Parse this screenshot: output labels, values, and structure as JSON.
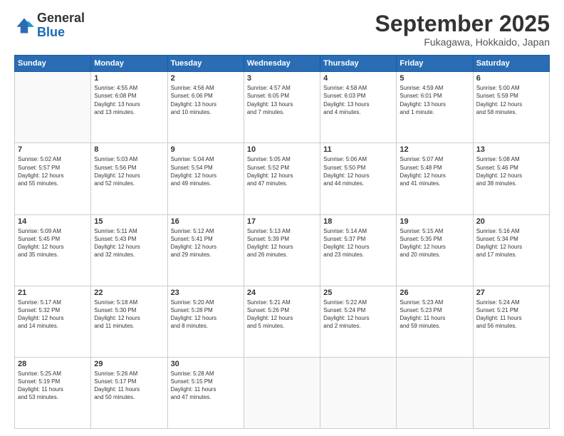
{
  "header": {
    "logo_general": "General",
    "logo_blue": "Blue",
    "month_title": "September 2025",
    "location": "Fukagawa, Hokkaido, Japan"
  },
  "weekdays": [
    "Sunday",
    "Monday",
    "Tuesday",
    "Wednesday",
    "Thursday",
    "Friday",
    "Saturday"
  ],
  "weeks": [
    [
      {
        "day": "",
        "info": ""
      },
      {
        "day": "1",
        "info": "Sunrise: 4:55 AM\nSunset: 6:08 PM\nDaylight: 13 hours\nand 13 minutes."
      },
      {
        "day": "2",
        "info": "Sunrise: 4:56 AM\nSunset: 6:06 PM\nDaylight: 13 hours\nand 10 minutes."
      },
      {
        "day": "3",
        "info": "Sunrise: 4:57 AM\nSunset: 6:05 PM\nDaylight: 13 hours\nand 7 minutes."
      },
      {
        "day": "4",
        "info": "Sunrise: 4:58 AM\nSunset: 6:03 PM\nDaylight: 13 hours\nand 4 minutes."
      },
      {
        "day": "5",
        "info": "Sunrise: 4:59 AM\nSunset: 6:01 PM\nDaylight: 13 hours\nand 1 minute."
      },
      {
        "day": "6",
        "info": "Sunrise: 5:00 AM\nSunset: 5:59 PM\nDaylight: 12 hours\nand 58 minutes."
      }
    ],
    [
      {
        "day": "7",
        "info": "Sunrise: 5:02 AM\nSunset: 5:57 PM\nDaylight: 12 hours\nand 55 minutes."
      },
      {
        "day": "8",
        "info": "Sunrise: 5:03 AM\nSunset: 5:56 PM\nDaylight: 12 hours\nand 52 minutes."
      },
      {
        "day": "9",
        "info": "Sunrise: 5:04 AM\nSunset: 5:54 PM\nDaylight: 12 hours\nand 49 minutes."
      },
      {
        "day": "10",
        "info": "Sunrise: 5:05 AM\nSunset: 5:52 PM\nDaylight: 12 hours\nand 47 minutes."
      },
      {
        "day": "11",
        "info": "Sunrise: 5:06 AM\nSunset: 5:50 PM\nDaylight: 12 hours\nand 44 minutes."
      },
      {
        "day": "12",
        "info": "Sunrise: 5:07 AM\nSunset: 5:48 PM\nDaylight: 12 hours\nand 41 minutes."
      },
      {
        "day": "13",
        "info": "Sunrise: 5:08 AM\nSunset: 5:46 PM\nDaylight: 12 hours\nand 38 minutes."
      }
    ],
    [
      {
        "day": "14",
        "info": "Sunrise: 5:09 AM\nSunset: 5:45 PM\nDaylight: 12 hours\nand 35 minutes."
      },
      {
        "day": "15",
        "info": "Sunrise: 5:11 AM\nSunset: 5:43 PM\nDaylight: 12 hours\nand 32 minutes."
      },
      {
        "day": "16",
        "info": "Sunrise: 5:12 AM\nSunset: 5:41 PM\nDaylight: 12 hours\nand 29 minutes."
      },
      {
        "day": "17",
        "info": "Sunrise: 5:13 AM\nSunset: 5:39 PM\nDaylight: 12 hours\nand 26 minutes."
      },
      {
        "day": "18",
        "info": "Sunrise: 5:14 AM\nSunset: 5:37 PM\nDaylight: 12 hours\nand 23 minutes."
      },
      {
        "day": "19",
        "info": "Sunrise: 5:15 AM\nSunset: 5:35 PM\nDaylight: 12 hours\nand 20 minutes."
      },
      {
        "day": "20",
        "info": "Sunrise: 5:16 AM\nSunset: 5:34 PM\nDaylight: 12 hours\nand 17 minutes."
      }
    ],
    [
      {
        "day": "21",
        "info": "Sunrise: 5:17 AM\nSunset: 5:32 PM\nDaylight: 12 hours\nand 14 minutes."
      },
      {
        "day": "22",
        "info": "Sunrise: 5:18 AM\nSunset: 5:30 PM\nDaylight: 12 hours\nand 11 minutes."
      },
      {
        "day": "23",
        "info": "Sunrise: 5:20 AM\nSunset: 5:28 PM\nDaylight: 12 hours\nand 8 minutes."
      },
      {
        "day": "24",
        "info": "Sunrise: 5:21 AM\nSunset: 5:26 PM\nDaylight: 12 hours\nand 5 minutes."
      },
      {
        "day": "25",
        "info": "Sunrise: 5:22 AM\nSunset: 5:24 PM\nDaylight: 12 hours\nand 2 minutes."
      },
      {
        "day": "26",
        "info": "Sunrise: 5:23 AM\nSunset: 5:23 PM\nDaylight: 11 hours\nand 59 minutes."
      },
      {
        "day": "27",
        "info": "Sunrise: 5:24 AM\nSunset: 5:21 PM\nDaylight: 11 hours\nand 56 minutes."
      }
    ],
    [
      {
        "day": "28",
        "info": "Sunrise: 5:25 AM\nSunset: 5:19 PM\nDaylight: 11 hours\nand 53 minutes."
      },
      {
        "day": "29",
        "info": "Sunrise: 5:26 AM\nSunset: 5:17 PM\nDaylight: 11 hours\nand 50 minutes."
      },
      {
        "day": "30",
        "info": "Sunrise: 5:28 AM\nSunset: 5:15 PM\nDaylight: 11 hours\nand 47 minutes."
      },
      {
        "day": "",
        "info": ""
      },
      {
        "day": "",
        "info": ""
      },
      {
        "day": "",
        "info": ""
      },
      {
        "day": "",
        "info": ""
      }
    ]
  ]
}
